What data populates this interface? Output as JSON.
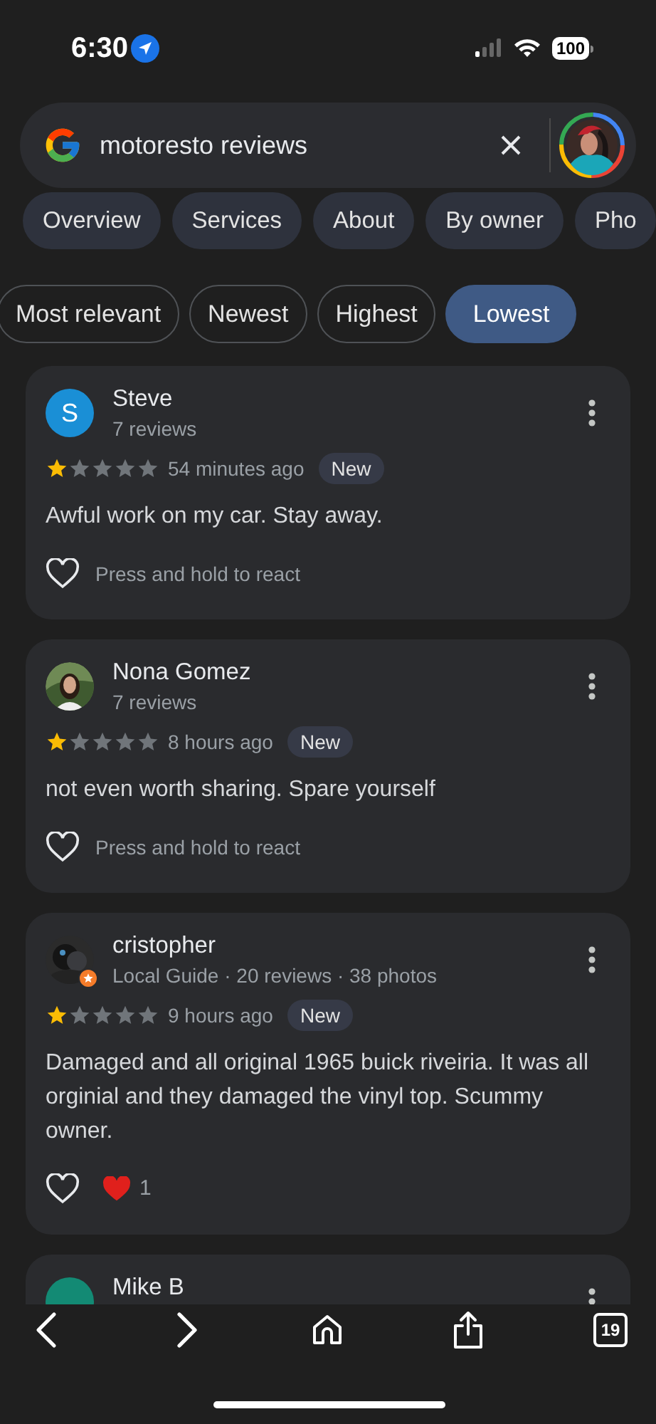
{
  "status_bar": {
    "time": "6:30",
    "battery": "100"
  },
  "search": {
    "value": "motoresto reviews"
  },
  "tabs": [
    {
      "label": "Overview",
      "selected": false
    },
    {
      "label": "Services",
      "selected": false
    },
    {
      "label": "About",
      "selected": false
    },
    {
      "label": "By owner",
      "selected": false
    },
    {
      "label": "Pho",
      "selected": false
    }
  ],
  "sort_chips": [
    {
      "label": "Most relevant",
      "selected": false
    },
    {
      "label": "Newest",
      "selected": false
    },
    {
      "label": "Highest",
      "selected": false
    },
    {
      "label": "Lowest",
      "selected": true
    }
  ],
  "reviews": [
    {
      "name": "Steve",
      "avatar": {
        "kind": "letter",
        "letter": "S",
        "color": "#1a8fd6"
      },
      "local_guide": false,
      "meta": "7 reviews",
      "stars": 1,
      "time": "54 minutes ago",
      "badge": "New",
      "text": "Awful work on my car. Stay away.",
      "reaction": {
        "kind": "hint",
        "hint": "Press and hold to react"
      }
    },
    {
      "name": "Nona Gomez",
      "local_guide": false,
      "meta": "7 reviews",
      "stars": 1,
      "time": "8 hours ago",
      "badge": "New",
      "text": "not even worth sharing. Spare yourself",
      "reaction": {
        "kind": "hint",
        "hint": "Press and hold to react"
      }
    },
    {
      "name": "cristopher",
      "local_guide": true,
      "meta": "Local Guide · 20 reviews · 38 photos",
      "stars": 1,
      "time": "9 hours ago",
      "badge": "New",
      "text": "Damaged and all original 1965 buick riveiria. It was all orginial and they damaged the vinyl top. Scummy owner.",
      "reaction": {
        "kind": "count",
        "count": "1"
      }
    },
    {
      "name": "Mike B",
      "avatar": {
        "kind": "plain",
        "color": "#138a74"
      },
      "local_guide": false
    }
  ],
  "toolbar": {
    "tab_count": "19"
  }
}
